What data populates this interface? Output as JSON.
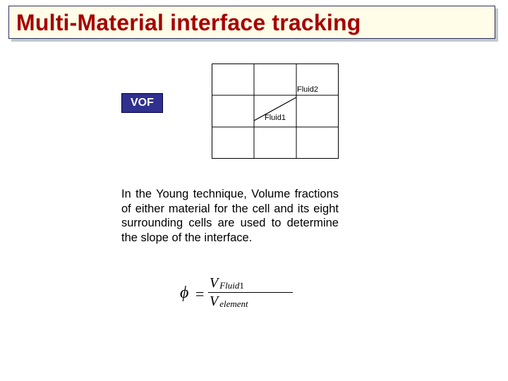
{
  "title": "Multi-Material interface tracking",
  "vof_label": "VOF",
  "figure": {
    "fluid2_label": "Fluid2",
    "fluid1_label": "Fluid1"
  },
  "body_paragraph": "In the Young technique, Volume fractions of either material for the cell and its eight surrounding cells are used to determine the slope of the interface.",
  "equation": {
    "lhs": "ϕ",
    "eq": "=",
    "num_var": "V",
    "num_sub_name": "Fluid",
    "num_sub_idx": "1",
    "den_var": "V",
    "den_sub": "element"
  }
}
